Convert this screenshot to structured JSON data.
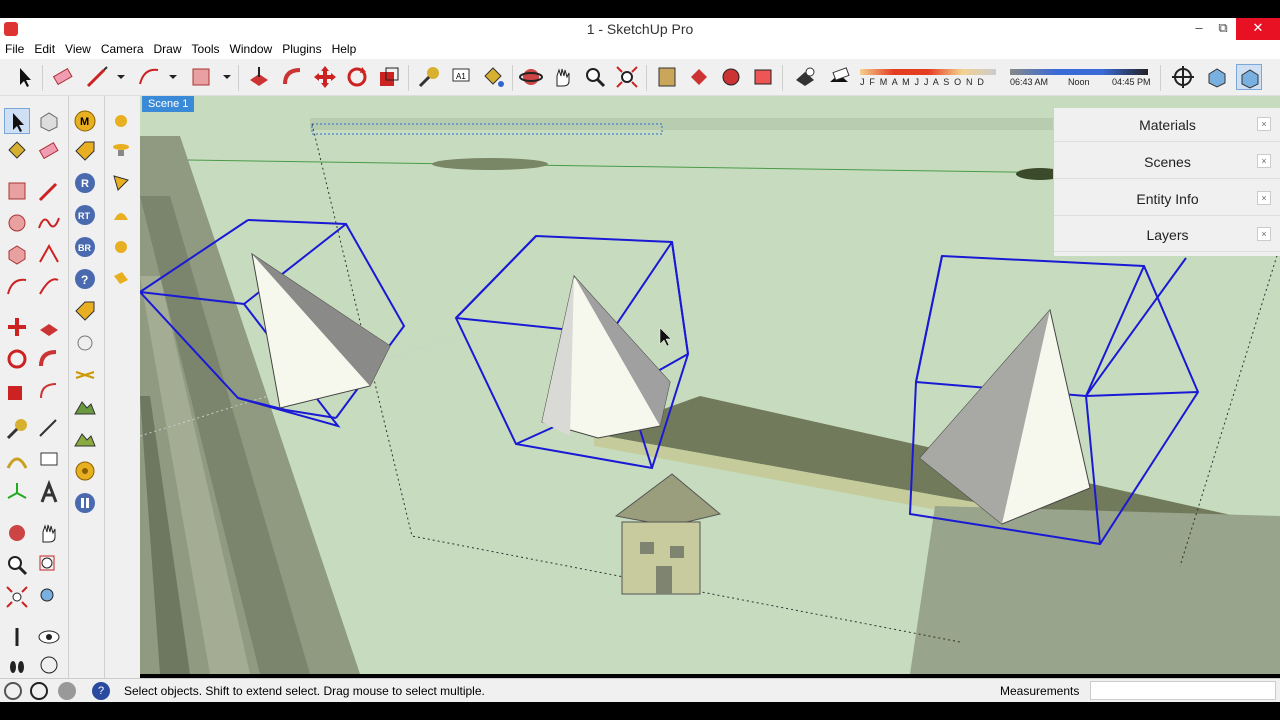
{
  "window": {
    "title": "1 - SketchUp Pro",
    "controls": [
      "minimize-icon",
      "restore-icon",
      "close-icon"
    ]
  },
  "menu": [
    "File",
    "Edit",
    "View",
    "Camera",
    "Draw",
    "Tools",
    "Window",
    "Plugins",
    "Help"
  ],
  "shadow_settings": {
    "months": "J F M A M J J A S O N D",
    "time_start": "06:43 AM",
    "time_mid": "Noon",
    "time_end": "04:45 PM"
  },
  "scene_tab": "Scene 1",
  "tray": {
    "panels": [
      "Materials",
      "Scenes",
      "Entity Info",
      "Layers"
    ],
    "close_symbol": "×"
  },
  "status": {
    "message": "Select objects. Shift to extend select. Drag mouse to select multiple.",
    "measurements_label": "Measurements",
    "measurements_value": ""
  },
  "colors": {
    "selection_blue": "#1a1ad6",
    "ground_green": "#c7dcbe",
    "scene_tab": "#3a8ad8"
  }
}
